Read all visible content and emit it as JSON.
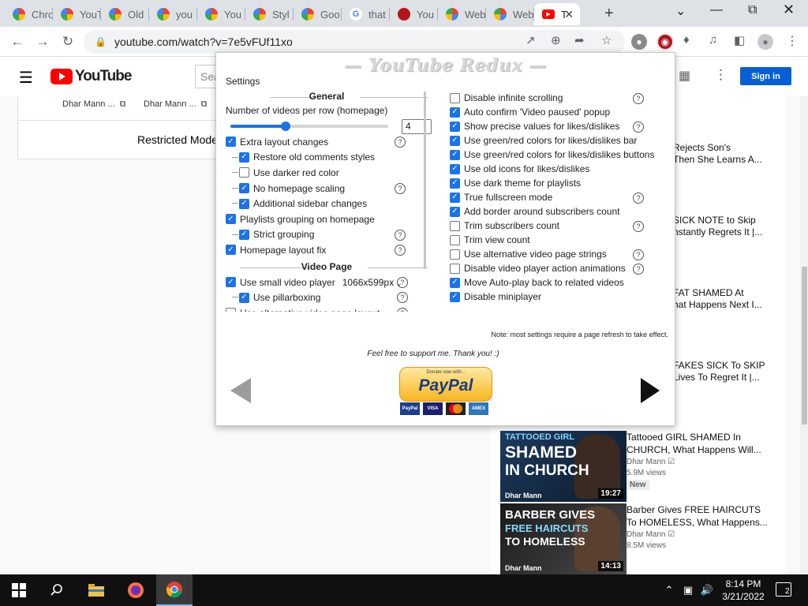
{
  "browser": {
    "tabs": [
      {
        "label": "Chro",
        "favicon": "rainbow-icon"
      },
      {
        "label": "YouT",
        "favicon": "rainbow-icon"
      },
      {
        "label": "Old",
        "favicon": "rainbow-icon"
      },
      {
        "label": "you",
        "favicon": "rainbow-icon"
      },
      {
        "label": "You",
        "favicon": "rainbow-icon"
      },
      {
        "label": "Styl",
        "favicon": "rainbow-icon"
      },
      {
        "label": "Goo",
        "favicon": "rainbow-icon"
      },
      {
        "label": "that",
        "favicon": "google-icon"
      },
      {
        "label": "You",
        "favicon": "redux-icon"
      },
      {
        "label": "Web",
        "favicon": "chrome-web-store-icon"
      },
      {
        "label": "Web",
        "favicon": "chrome-web-store-icon"
      },
      {
        "label": "T",
        "favicon": "youtube-icon"
      }
    ],
    "url": "youtube.com/watch?v=7e5vFUf11xo"
  },
  "youtube": {
    "search_placeholder": "Sea",
    "sign_in": "Sign in",
    "credit_links": [
      "Dhar Mann ...",
      "Dhar Mann ..."
    ],
    "restricted_text": "Restricted Mode h",
    "partial_titles": [
      [
        "Rejects Son's",
        "Then She Learns A..."
      ],
      [
        "SICK NOTE to Skip",
        "nstantly Regrets It |..."
      ],
      [
        "FAT SHAMED At",
        "hat Happens Next I..."
      ],
      [
        "FAKES SICK To SKIP",
        "Lives To Regret It |..."
      ]
    ],
    "recommendations": [
      {
        "thumb_lines": [
          "TATTOOED GIRL",
          "SHAMED",
          "IN CHURCH"
        ],
        "thumb_channel": "Dhar Mann",
        "duration": "19:27",
        "title_lines": [
          "Tattooed GIRL SHAMED In",
          "CHURCH, What Happens Will..."
        ],
        "channel": "Dhar Mann",
        "views": "5.9M views",
        "badge": "New"
      },
      {
        "thumb_lines": [
          "BARBER GIVES",
          "FREE HAIRCUTS",
          "TO HOMELESS"
        ],
        "thumb_channel": "Dhar Mann",
        "duration": "14:13",
        "title_lines": [
          "Barber Gives FREE HAIRCUTS",
          "To HOMELESS, What Happens..."
        ],
        "channel": "Dhar Mann",
        "views": "8.5M views",
        "badge": ""
      }
    ]
  },
  "popup": {
    "title": "— YouTube Redux —",
    "settings_label": "Settings",
    "general_header": "General",
    "videos_per_row_label": "Number of videos per row (homepage)",
    "videos_per_row_value": "4",
    "videos_per_row_fraction": 0.35,
    "left_options": [
      {
        "label": "Extra layout changes",
        "checked": true,
        "sub": false,
        "help": true
      },
      {
        "label": "Restore old comments styles",
        "checked": true,
        "sub": true,
        "help": false
      },
      {
        "label": "Use darker red color",
        "checked": false,
        "sub": true,
        "help": false
      },
      {
        "label": "No homepage scaling",
        "checked": true,
        "sub": true,
        "help": true
      },
      {
        "label": "Additional sidebar changes",
        "checked": true,
        "sub": true,
        "help": false
      },
      {
        "label": "Playlists grouping on homepage",
        "checked": true,
        "sub": false,
        "help": false
      },
      {
        "label": "Strict grouping",
        "checked": true,
        "sub": true,
        "help": true
      },
      {
        "label": "Homepage layout fix",
        "checked": true,
        "sub": false,
        "help": true
      }
    ],
    "video_page_header": "Video Page",
    "video_options": [
      {
        "label": "Use small video player",
        "checked": true,
        "sub": false,
        "help": true,
        "dropdown": "1066x599px"
      },
      {
        "label": "Use pillarboxing",
        "checked": true,
        "sub": true,
        "help": true
      },
      {
        "label": "Use alternative video page layout",
        "checked": false,
        "sub": false,
        "help": true
      }
    ],
    "right_options": [
      {
        "label": "Disable infinite scrolling",
        "checked": false,
        "help": true
      },
      {
        "label": "Auto confirm 'Video paused' popup",
        "checked": true,
        "help": false
      },
      {
        "label": "Show precise values for likes/dislikes",
        "checked": true,
        "help": true
      },
      {
        "label": "Use green/red colors for likes/dislikes bar",
        "checked": true,
        "help": false
      },
      {
        "label": "Use green/red colors for likes/dislikes buttons",
        "checked": true,
        "help": false
      },
      {
        "label": "Use old icons for likes/dislikes",
        "checked": true,
        "help": false
      },
      {
        "label": "Use dark theme for playlists",
        "checked": true,
        "help": false
      },
      {
        "label": "True fullscreen mode",
        "checked": true,
        "help": true
      },
      {
        "label": "Add border around subscribers count",
        "checked": true,
        "help": false
      },
      {
        "label": "Trim subscribers count",
        "checked": false,
        "help": true
      },
      {
        "label": "Trim view count",
        "checked": false,
        "help": false
      },
      {
        "label": "Use alternative video page strings",
        "checked": false,
        "help": true
      },
      {
        "label": "Disable video player action animations",
        "checked": false,
        "help": true
      },
      {
        "label": "Move Auto-play back to related videos",
        "checked": true,
        "help": false
      },
      {
        "label": "Disable miniplayer",
        "checked": true,
        "help": false
      }
    ],
    "note": "Note: most settings require a page refresh to take effect.",
    "support": "Feel free to support me. Thank you! :)",
    "paypal_donate": "Donate now with...",
    "paypal_label": "PayPal",
    "payment_cards": [
      "PayPal",
      "VISA",
      "MC",
      "AMEX"
    ]
  },
  "taskbar": {
    "time": "8:14 PM",
    "date": "3/21/2022",
    "notifications": "2"
  },
  "colors": {
    "accent": "#1a73e8",
    "youtube_red": "#ff0000",
    "signin_blue": "#065fd4"
  }
}
